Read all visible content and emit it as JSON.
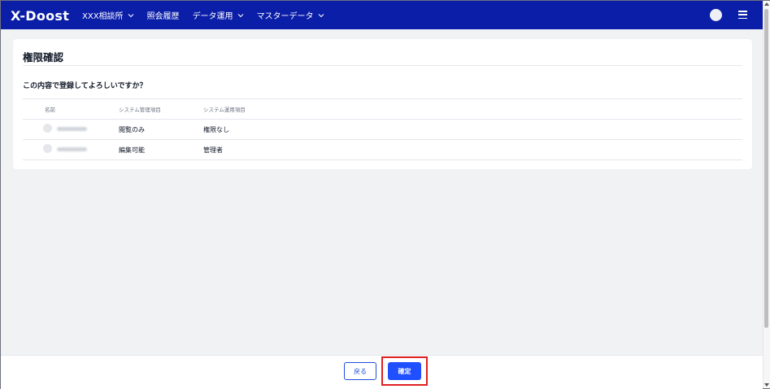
{
  "header": {
    "logo": "X-Doost",
    "nav": [
      {
        "label": "XXX相談所",
        "has_dropdown": true
      },
      {
        "label": "照会履歴",
        "has_dropdown": false
      },
      {
        "label": "データ運用",
        "has_dropdown": true
      },
      {
        "label": "マスターデータ",
        "has_dropdown": true
      }
    ],
    "avatar_icon": "user-avatar",
    "menu_icon": "hamburger-menu-icon"
  },
  "main": {
    "title": "権限確認",
    "question": "この内容で登録してよろしいですか？",
    "table": {
      "columns": [
        "名前",
        "システム管理項目",
        "システム運用項目"
      ],
      "rows": [
        {
          "name": "",
          "system_admin": "閲覧のみ",
          "system_ops": "権限なし"
        },
        {
          "name": "",
          "system_admin": "編集可能",
          "system_ops": "管理者"
        }
      ]
    }
  },
  "footer": {
    "back_label": "戻る",
    "confirm_label": "確定"
  },
  "colors": {
    "header_bg": "#0b1ea8",
    "primary": "#1f4fff",
    "highlight": "#e02020",
    "page_bg": "#f1f2f4"
  }
}
